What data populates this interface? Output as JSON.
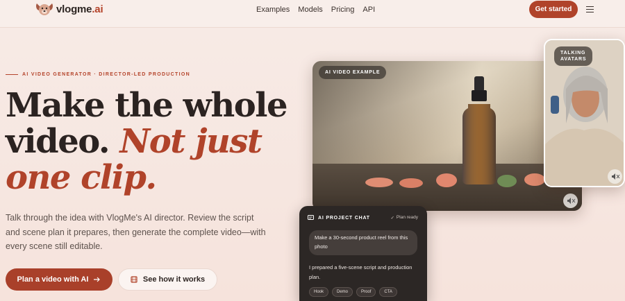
{
  "brand": {
    "name_main": "vlogme",
    "name_suffix": ".ai"
  },
  "nav": {
    "links": [
      "Examples",
      "Models",
      "Pricing",
      "API"
    ],
    "cta": "Get started"
  },
  "hero": {
    "eyebrow": "AI VIDEO GENERATOR · DIRECTOR-LED PRODUCTION",
    "headline_line1": "Make the whole",
    "headline_line2a": "video. ",
    "headline_line2b": "Not just",
    "headline_line3": "one clip.",
    "subtext": "Talk through the idea with VlogMe's AI director. Review the script and scene plan it prepares, then generate the complete video—with every scene still editable.",
    "primary_button": "Plan a video with AI",
    "secondary_button": "See how it works"
  },
  "video_card": {
    "label": "AI VIDEO EXAMPLE"
  },
  "avatar_card": {
    "label_line1": "TALKING",
    "label_line2": "AVATARS"
  },
  "chat": {
    "title": "AI PROJECT CHAT",
    "status": "Plan ready",
    "user_message": "Make a 30-second product reel from this photo",
    "reply": "I prepared a five-scene script and production plan.",
    "tags": [
      "Hook",
      "Demo",
      "Proof",
      "CTA"
    ]
  },
  "colors": {
    "accent": "#b0432a",
    "background": "#f7ebe6",
    "chat_bg": "#2c2725"
  }
}
